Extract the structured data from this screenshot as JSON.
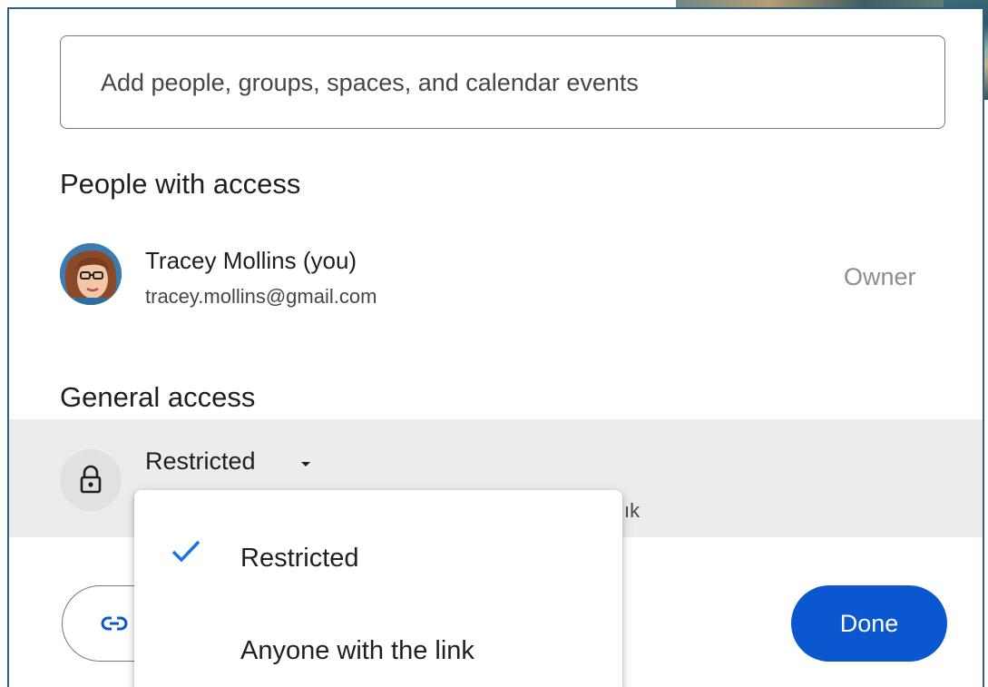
{
  "search": {
    "placeholder": "Add people, groups, spaces, and calendar events"
  },
  "people_section": {
    "heading": "People with access",
    "people": [
      {
        "name": "Tracey Mollins (you)",
        "email": "tracey.mollins@gmail.com",
        "role": "Owner"
      }
    ]
  },
  "general_access": {
    "heading": "General access",
    "selected": "Restricted",
    "description_visible_fragment": "ık"
  },
  "footer": {
    "done_label": "Done"
  },
  "access_menu": {
    "options": [
      {
        "label": "Restricted",
        "checked": true
      },
      {
        "label": "Anyone with the link",
        "checked": false
      }
    ]
  },
  "colors": {
    "primary": "#0b57d0",
    "check": "#1a73e8",
    "row_highlight": "#ececec",
    "dialog_border": "#2f5f86"
  },
  "icons": {
    "lock": "lock-icon",
    "caret": "arrow-drop-down-icon",
    "link": "link-icon",
    "check": "check-icon"
  }
}
